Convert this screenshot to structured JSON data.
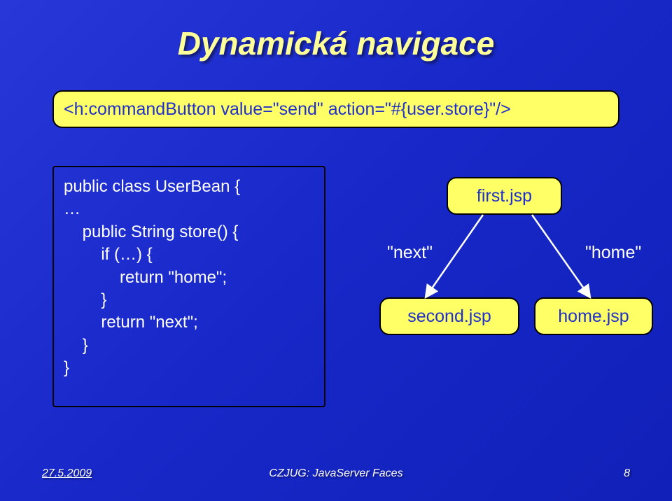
{
  "title": "Dynamická navigace",
  "snippet": "<h:commandButton value=\"send\" action=\"#{user.store}\"/>",
  "code": "public class UserBean {\n…\n    public String store() {\n        if (…) {\n            return \"home\";\n        }\n        return \"next\";\n    }\n}",
  "labels": {
    "next": "\"next\"",
    "home": "\"home\""
  },
  "nodes": {
    "first": "first.jsp",
    "second": "second.jsp",
    "home": "home.jsp"
  },
  "footer": {
    "date": "27.5.2009",
    "title": "CZJUG: JavaServer Faces",
    "page": "8"
  }
}
